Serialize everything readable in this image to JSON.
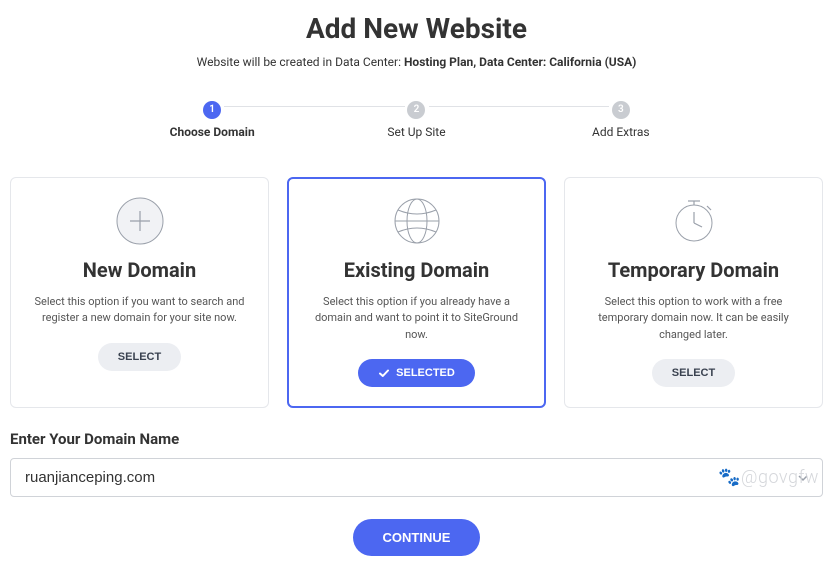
{
  "title": "Add New Website",
  "subtitle_prefix": "Website will be created in Data Center: ",
  "subtitle_bold": "Hosting Plan, Data Center: California (USA)",
  "steps": [
    {
      "num": "1",
      "label": "Choose Domain",
      "active": true
    },
    {
      "num": "2",
      "label": "Set Up Site",
      "active": false
    },
    {
      "num": "3",
      "label": "Add Extras",
      "active": false
    }
  ],
  "cards": [
    {
      "title": "New Domain",
      "desc": "Select this option if you want to search and register a new domain for your site now.",
      "button": "SELECT",
      "selected": false
    },
    {
      "title": "Existing Domain",
      "desc": "Select this option if you already have a domain and want to point it to SiteGround now.",
      "button": "SELECTED",
      "selected": true
    },
    {
      "title": "Temporary Domain",
      "desc": "Select this option to work with a free temporary domain now. It can be easily changed later.",
      "button": "SELECT",
      "selected": false
    }
  ],
  "domain_section_label": "Enter Your Domain Name",
  "domain_value": "ruanjianceping.com",
  "continue_label": "CONTINUE",
  "watermark": "@govgfw"
}
